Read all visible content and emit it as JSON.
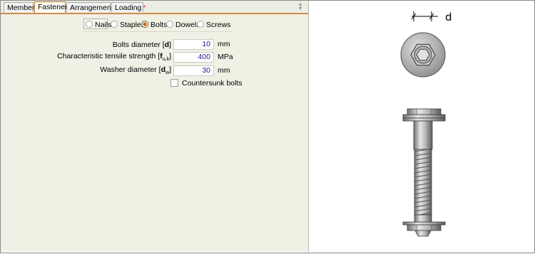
{
  "tabs": [
    {
      "label": "Members",
      "star": ""
    },
    {
      "label": "Fasteners",
      "star": ""
    },
    {
      "label": "Arrangement",
      "star": "*"
    },
    {
      "label": "Loading",
      "star": "*"
    }
  ],
  "fastener_types": [
    {
      "label": "Nails",
      "selected": false
    },
    {
      "label": "Staples",
      "selected": false
    },
    {
      "label": "Bolts",
      "selected": true
    },
    {
      "label": "Dowels",
      "selected": false
    },
    {
      "label": "Screws",
      "selected": false
    }
  ],
  "fields": {
    "diameter": {
      "label": "Bolts diameter [",
      "sym": "d",
      "sub": "",
      "close": "]",
      "value": "10",
      "unit": "mm"
    },
    "tensile": {
      "label": "Characteristic tensile strength [",
      "sym": "f",
      "sub": "u,k",
      "close": "]",
      "value": "400",
      "unit": "MPa"
    },
    "washer": {
      "label": "Washer diameter [",
      "sym": "d",
      "sub": "w",
      "close": "]",
      "value": "30",
      "unit": "mm"
    }
  },
  "countersunk": {
    "label": "Countersunk bolts",
    "checked": false
  },
  "drawing": {
    "dimension_label": "d"
  },
  "colors": {
    "accent": "#d58a48",
    "panel_bg": "#eff1e4",
    "input_text": "#1a1a8c"
  }
}
